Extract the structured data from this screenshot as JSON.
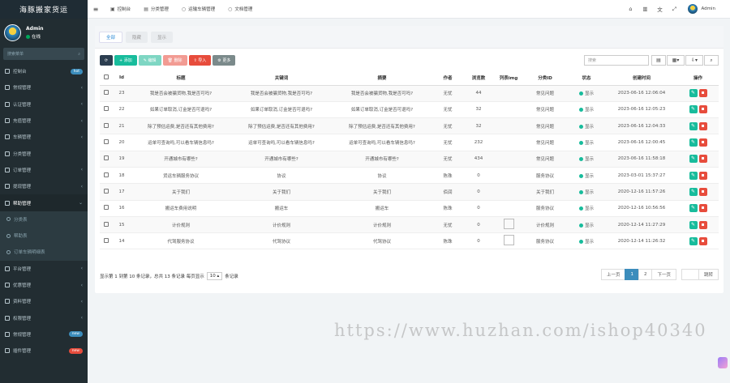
{
  "app": {
    "title": "海豚搬家货运"
  },
  "user": {
    "name": "Admin",
    "status": "在线"
  },
  "sidebar": {
    "search_placeholder": "搜索菜单",
    "items": [
      {
        "label": "控制台",
        "badge": "hot",
        "badge_color": "#3c8dbc"
      },
      {
        "label": "常规管理",
        "chev": "‹"
      },
      {
        "label": "认证管理",
        "chev": "‹"
      },
      {
        "label": "充值管理",
        "chev": "‹"
      },
      {
        "label": "车辆管理",
        "chev": "‹"
      },
      {
        "label": "分类管理"
      },
      {
        "label": "订单管理",
        "chev": "‹"
      },
      {
        "label": "提现管理",
        "chev": "‹"
      },
      {
        "label": "帮助管理",
        "chev": "⌄",
        "open": true
      }
    ],
    "sub_items": [
      {
        "label": "分类表"
      },
      {
        "label": "帮助表"
      },
      {
        "label": "订单车辆明细表"
      }
    ],
    "items_after": [
      {
        "label": "平台管理",
        "chev": "‹"
      },
      {
        "label": "优惠管理",
        "chev": "‹"
      },
      {
        "label": "资料管理",
        "chev": "‹"
      },
      {
        "label": "权限管理",
        "chev": "‹"
      },
      {
        "label": "常规管理",
        "badge": "new",
        "badge_color": "#3c8dbc"
      },
      {
        "label": "插件管理",
        "badge": "new",
        "badge_color": "#e74c3c"
      }
    ]
  },
  "topbar": {
    "tabs": [
      {
        "label": "控制台",
        "icon": "dashboard-icon"
      },
      {
        "label": "分类管理",
        "icon": "folder-icon"
      },
      {
        "label": "运输车辆管理",
        "icon": "circle-icon"
      },
      {
        "label": "文档管理",
        "icon": "circle-icon"
      }
    ],
    "user": "Admin"
  },
  "panel": {
    "tabs": [
      "全部",
      "隐藏",
      "显示"
    ],
    "toolbar": {
      "add": "+ 添加",
      "edit": "✎ 编辑",
      "delete": "🗑 删除",
      "import": "⇪ 导入",
      "more": "⚙ 更多"
    },
    "search_placeholder": "搜索"
  },
  "table": {
    "headers": [
      "",
      "Id",
      "标题",
      "关键词",
      "摘要",
      "作者",
      "浏览数",
      "列表img",
      "分类ID",
      "状态",
      "创建时间",
      "操作"
    ],
    "rows": [
      {
        "id": "23",
        "title": "我是否会被骗货物,我是否可吗?",
        "kw": "我是否会被骗货物,我是否可吗?",
        "summary": "我是否会被骗货物,我是否可吗?",
        "author": "无忧",
        "views": "44",
        "img": false,
        "cat": "常见问题",
        "status": "显示",
        "created": "2023-06-16 12:06:04"
      },
      {
        "id": "22",
        "title": "如果订单取消,订金是否可退吗?",
        "kw": "如果订单取消,订金是否可退吗?",
        "summary": "如果订单取消,订金是否可退吗?",
        "author": "无忧",
        "views": "32",
        "img": false,
        "cat": "常见问题",
        "status": "显示",
        "created": "2023-06-16 12:05:23"
      },
      {
        "id": "21",
        "title": "除了预估运费,是否还有其他费用?",
        "kw": "除了预估运费,是否还有其他费用?",
        "summary": "除了预估运费,是否还有其他费用?",
        "author": "无忧",
        "views": "32",
        "img": false,
        "cat": "常见问题",
        "status": "显示",
        "created": "2023-06-16 12:04:33"
      },
      {
        "id": "20",
        "title": "运单可查询吗,可以看车辆信息吗?",
        "kw": "运单可查询吗,可以看车辆信息吗?",
        "summary": "运单可查询吗,可以看车辆信息吗?",
        "author": "无忧",
        "views": "232",
        "img": false,
        "cat": "常见问题",
        "status": "显示",
        "created": "2023-06-16 12:00:45"
      },
      {
        "id": "19",
        "title": "开通城市有哪些?",
        "kw": "开通城市有哪些?",
        "summary": "开通城市有哪些?",
        "author": "无忧",
        "views": "434",
        "img": false,
        "cat": "常见问题",
        "status": "显示",
        "created": "2023-06-16 11:58:18"
      },
      {
        "id": "18",
        "title": "货运车辆服务协议",
        "kw": "协议",
        "summary": "协议",
        "author": "陈珠",
        "views": "0",
        "img": false,
        "cat": "服务协议",
        "status": "显示",
        "created": "2023-03-01 15:37:27"
      },
      {
        "id": "17",
        "title": "关于我们",
        "kw": "关于我们",
        "summary": "关于我们",
        "author": "佰润",
        "views": "0",
        "img": false,
        "cat": "关于我们",
        "status": "显示",
        "created": "2020-12-16 11:57:26"
      },
      {
        "id": "16",
        "title": "搬运车费用说明",
        "kw": "搬运车",
        "summary": "搬运车",
        "author": "陈珠",
        "views": "0",
        "img": false,
        "cat": "服务协议",
        "status": "显示",
        "created": "2020-12-16 10:56:56"
      },
      {
        "id": "15",
        "title": "计价规则",
        "kw": "计价规则",
        "summary": "计价规则",
        "author": "无忧",
        "views": "0",
        "img": true,
        "cat": "计价规则",
        "status": "显示",
        "created": "2020-12-14 11:27:29"
      },
      {
        "id": "14",
        "title": "代驾服务协议",
        "kw": "代驾协议",
        "summary": "代驾协议",
        "author": "陈珠",
        "views": "0",
        "img": true,
        "cat": "服务协议",
        "status": "显示",
        "created": "2020-12-14 11:26:32"
      }
    ]
  },
  "footer": {
    "info_prefix": "显示第 1 到第 10 条记录，总共 13 条记录 每页显示",
    "page_size": "10",
    "info_suffix": "条记录",
    "prev": "上一页",
    "pages": [
      "1",
      "2"
    ],
    "next": "下一页",
    "jump": "跳转"
  },
  "watermark": "https://www.huzhan.com/ishop40340"
}
